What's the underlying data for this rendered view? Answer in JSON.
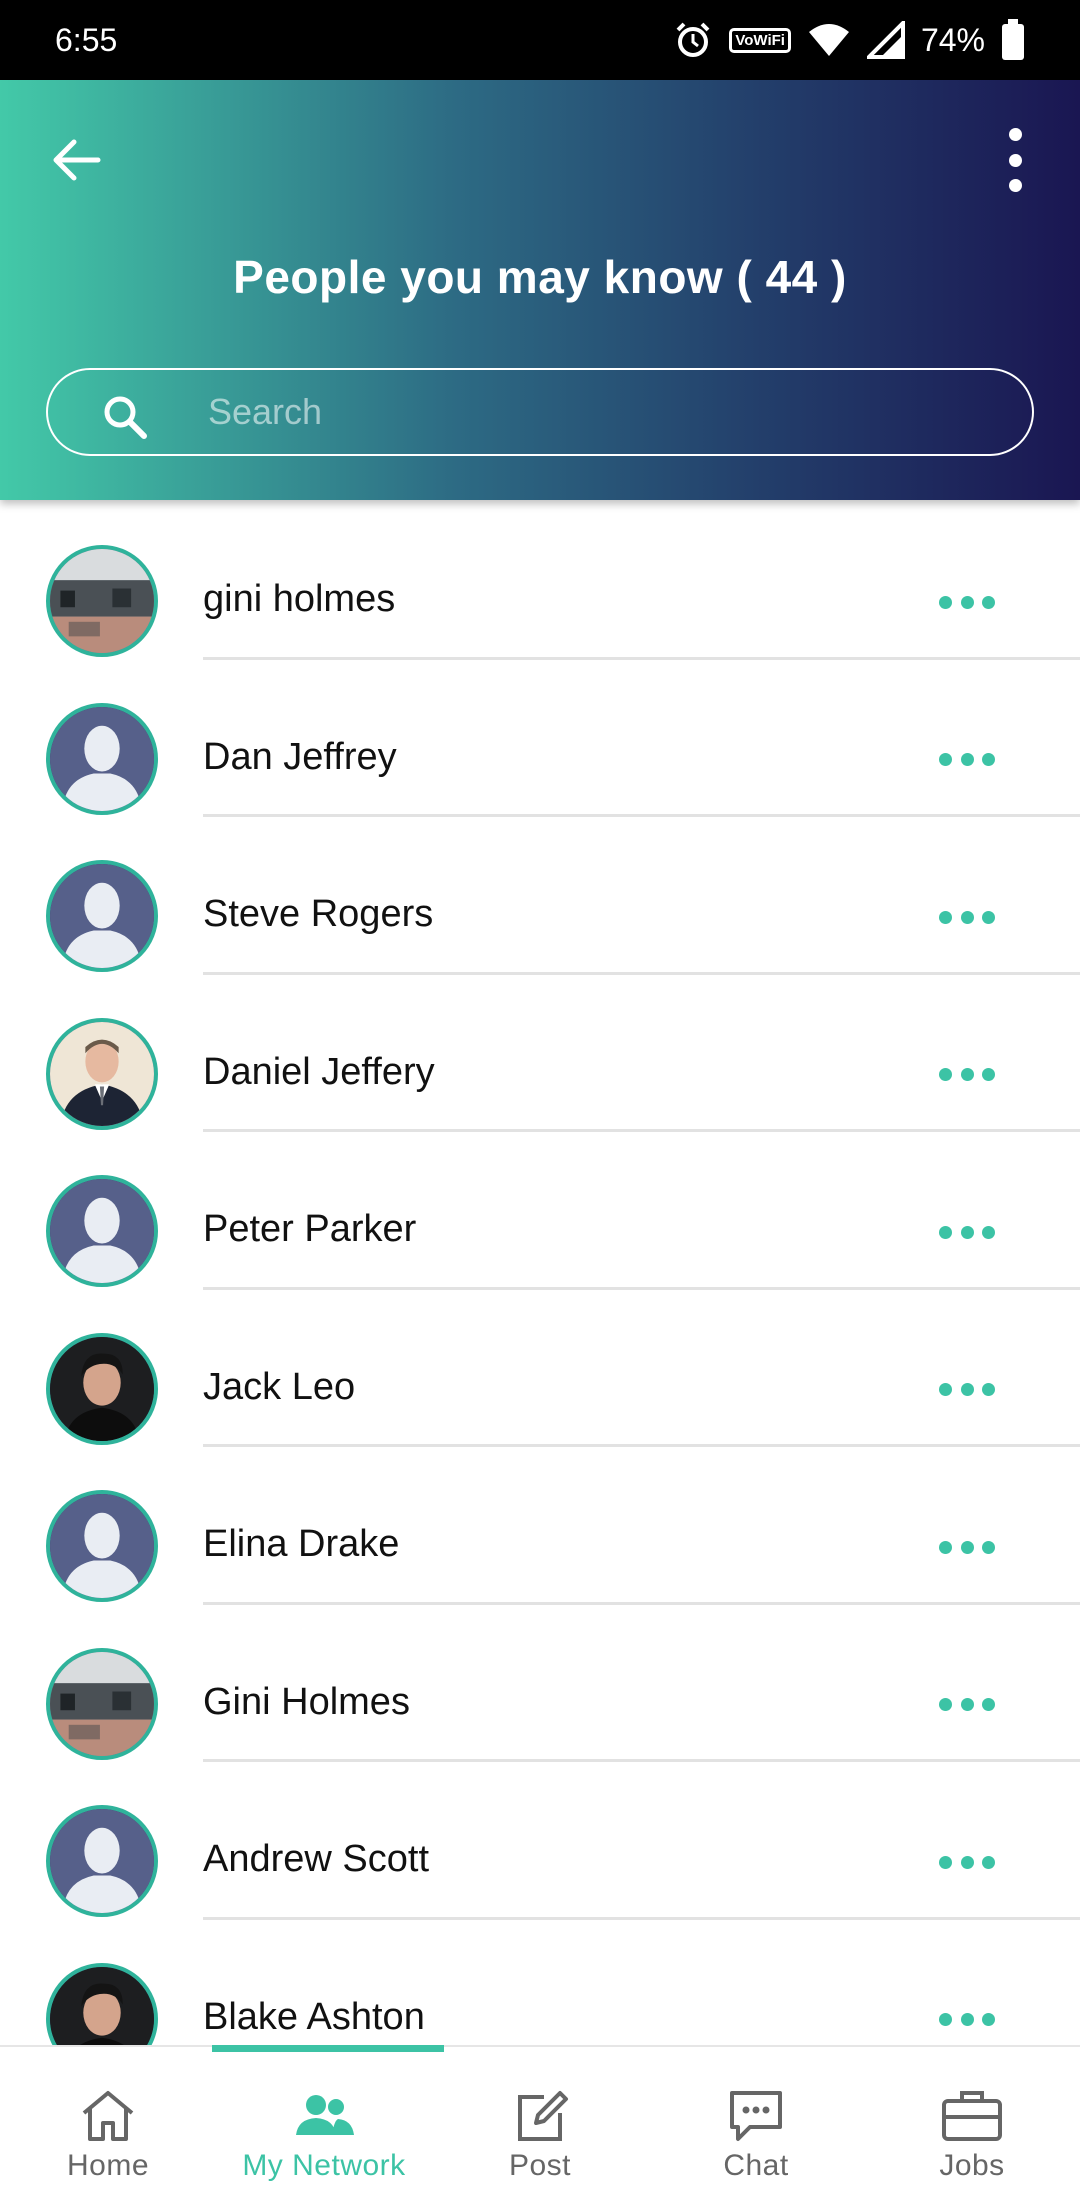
{
  "status_bar": {
    "time": "6:55",
    "battery": "74%",
    "wifi_badge_top": "Vo",
    "wifi_badge_bottom": "WiFi"
  },
  "header": {
    "title": "People you may know ( 44 )",
    "search_placeholder": "Search"
  },
  "people": [
    {
      "name": "gini holmes",
      "avatar": "office"
    },
    {
      "name": "Dan Jeffrey",
      "avatar": "default"
    },
    {
      "name": "Steve Rogers",
      "avatar": "default"
    },
    {
      "name": "Daniel Jeffery",
      "avatar": "suit"
    },
    {
      "name": "Peter Parker",
      "avatar": "default"
    },
    {
      "name": "Jack Leo",
      "avatar": "dark"
    },
    {
      "name": "Elina Drake",
      "avatar": "default"
    },
    {
      "name": "Gini Holmes",
      "avatar": "office"
    },
    {
      "name": "Andrew Scott",
      "avatar": "default"
    },
    {
      "name": "Blake Ashton",
      "avatar": "dark"
    }
  ],
  "bottom_nav": [
    {
      "label": "Home",
      "icon": "home-icon",
      "active": false
    },
    {
      "label": "My Network",
      "icon": "people-icon",
      "active": true
    },
    {
      "label": "Post",
      "icon": "edit-icon",
      "active": false
    },
    {
      "label": "Chat",
      "icon": "chat-icon",
      "active": false
    },
    {
      "label": "Jobs",
      "icon": "briefcase-icon",
      "active": false
    }
  ],
  "colors": {
    "accent": "#3cc3a5",
    "header_start": "#43c9a8",
    "header_end": "#1a1652"
  }
}
